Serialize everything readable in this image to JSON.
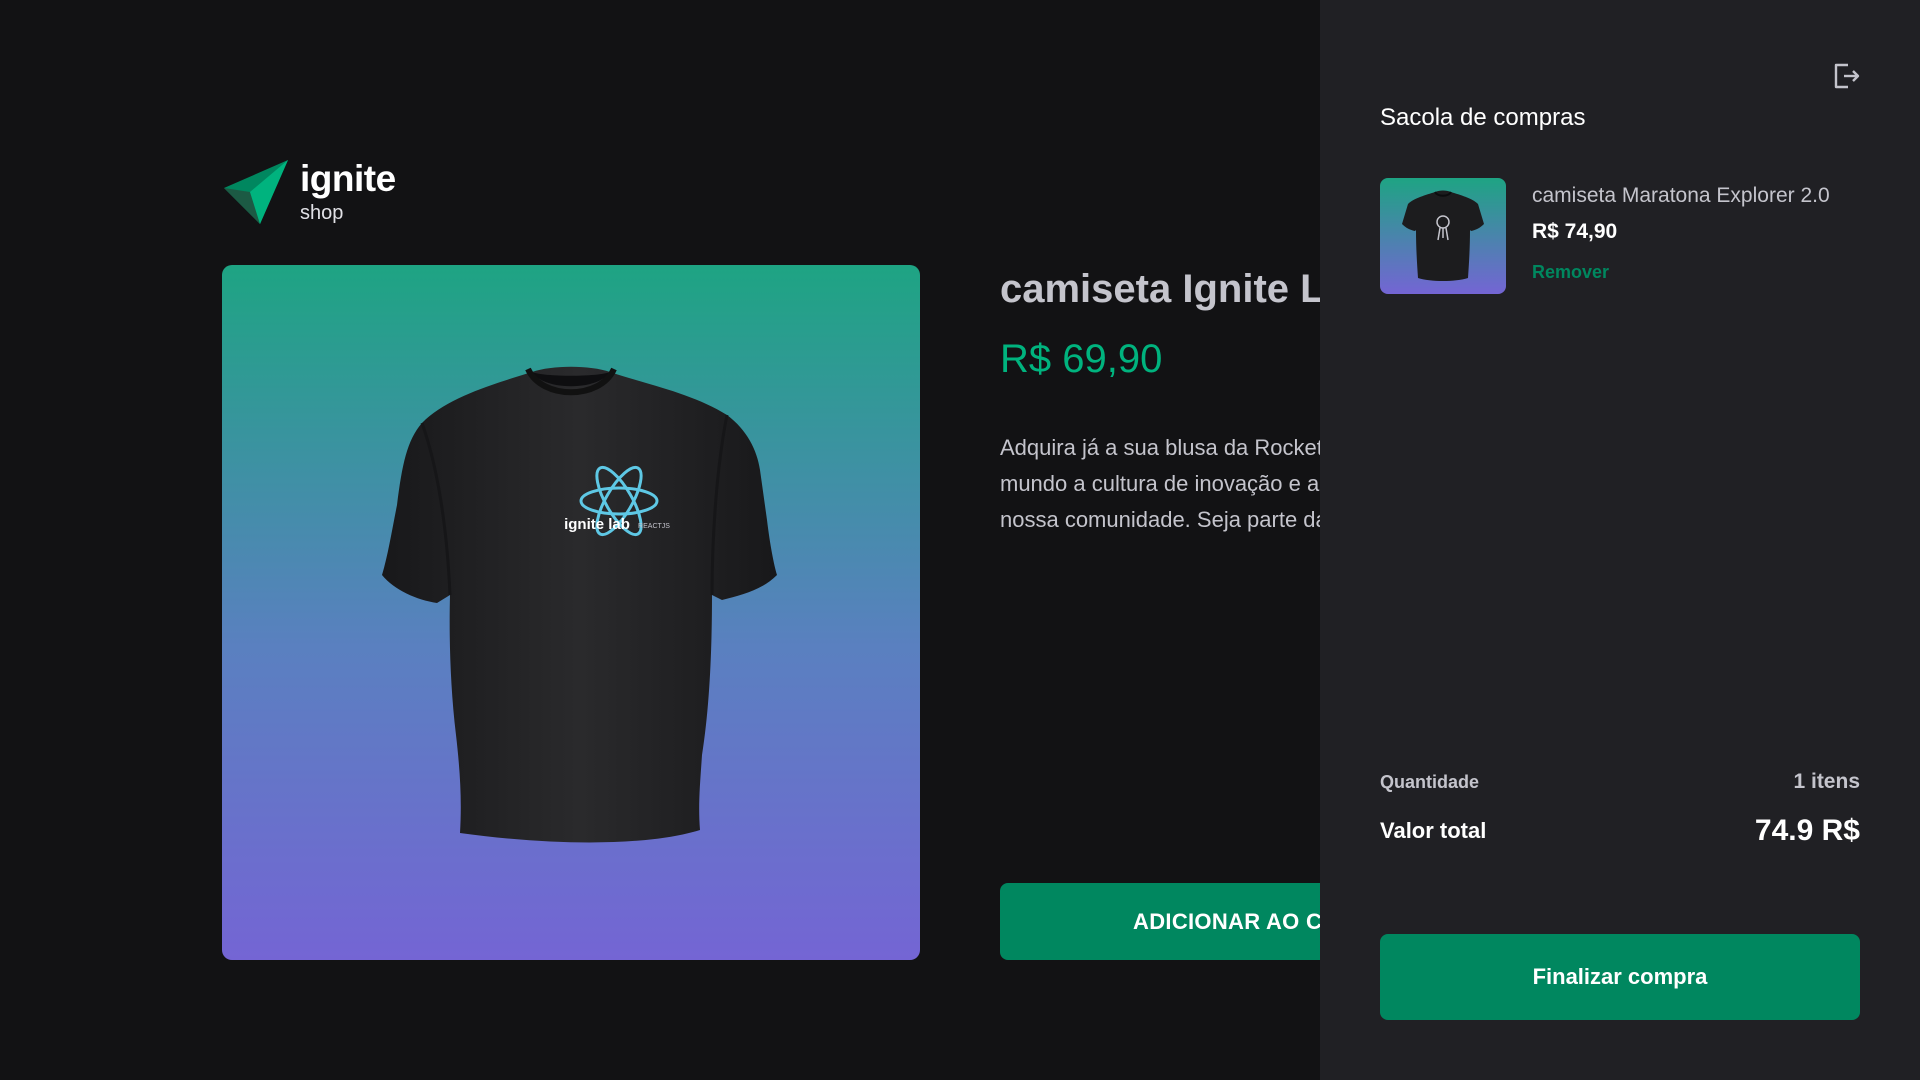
{
  "brand": {
    "title": "ignite",
    "subtitle": "shop"
  },
  "product": {
    "title": "camiseta Ignite Lab",
    "price": "R$ 69,90",
    "description": "Adquira já a sua blusa da Rocketseat e mostre ao mundo a cultura de inovação e aprendizado contínuo da nossa comunidade. Seja parte da revolução!",
    "image_print": "ignite lab",
    "image_print_sub": "REACTJS",
    "add_label": "ADICIONAR AO CARRINHO"
  },
  "cart": {
    "title": "Sacola de compras",
    "items": [
      {
        "name": "camiseta Maratona Explorer 2.0",
        "price": "R$ 74,90",
        "remove_label": "Remover"
      }
    ],
    "quantity_label": "Quantidade",
    "quantity_value": "1 itens",
    "total_label": "Valor total",
    "total_value": "74.9 R$",
    "checkout_label": "Finalizar compra"
  },
  "icons": {
    "logo": "ignite-logo-icon",
    "close": "sign-out-icon"
  },
  "colors": {
    "background": "#121214",
    "drawer": "#202024",
    "accent": "#00875f",
    "price": "#00b37e",
    "gradient_top": "#1ea483",
    "gradient_bottom": "#7465d4"
  }
}
